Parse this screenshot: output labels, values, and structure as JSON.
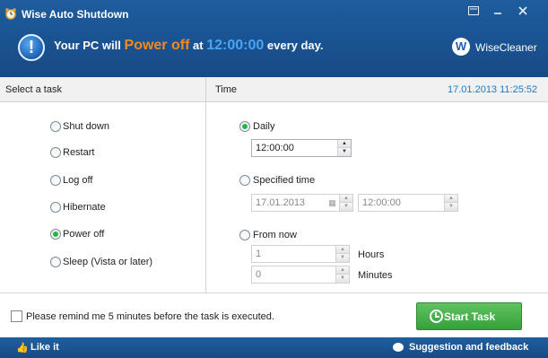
{
  "window": {
    "title": "Wise Auto Shutdown",
    "controls": [
      "menu",
      "minimize",
      "close"
    ]
  },
  "banner": {
    "prefix": "Your PC will",
    "action": "Power off",
    "at": "at",
    "time": "12:00:00",
    "suffix": "every day.",
    "brand": "WiseCleaner",
    "brand_logo_letter": "W"
  },
  "headers": {
    "task": "Select a task",
    "time": "Time",
    "datetime": "17.01.2013 11:25:52"
  },
  "tasks": [
    {
      "label": "Shut down",
      "selected": false
    },
    {
      "label": "Restart",
      "selected": false
    },
    {
      "label": "Log off",
      "selected": false
    },
    {
      "label": "Hibernate",
      "selected": false
    },
    {
      "label": "Power off",
      "selected": true
    },
    {
      "label": "Sleep (Vista or later)",
      "selected": false
    }
  ],
  "time_options": {
    "daily": {
      "label": "Daily",
      "selected": true,
      "value": "12:00:00"
    },
    "specified": {
      "label": "Specified time",
      "selected": false,
      "date": "17.01.2013",
      "time": "12:00:00"
    },
    "from_now": {
      "label": "From now",
      "selected": false,
      "hours": "1",
      "hours_label": "Hours",
      "minutes": "0",
      "minutes_label": "Minutes"
    }
  },
  "remind": {
    "label": "Please remind me 5 minutes before the task is executed.",
    "checked": false
  },
  "start_button": "Start Task",
  "footer": {
    "like": "Like it",
    "suggestion": "Suggestion and feedback"
  },
  "colors": {
    "title_bar": "#1a5291",
    "action_orange": "#f08a21",
    "time_blue": "#46a6f5",
    "header_datetime": "#1c7bc4",
    "start_green": "#36a03b",
    "radio_selected": "#2bb34a"
  }
}
